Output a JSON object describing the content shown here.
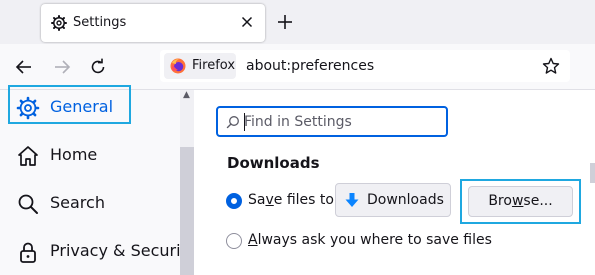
{
  "colors": {
    "accent": "#0061e0",
    "highlight_annotation": "#1fa8e0",
    "tab_background": "#ffffff",
    "chrome_background": "#f0f0f4"
  },
  "tab": {
    "title": "Settings",
    "icon": "gear-icon",
    "close_icon": "close-icon"
  },
  "toolbar": {
    "new_tab_icon": "plus-icon",
    "back_icon": "arrow-left-icon",
    "forward_icon": "arrow-right-icon",
    "reload_icon": "reload-icon"
  },
  "urlbar": {
    "identity_label": "Firefox",
    "url": "about:preferences",
    "bookmark_icon": "star-icon"
  },
  "sidebar": {
    "items": [
      {
        "label": "General",
        "icon": "gear-icon",
        "selected": true
      },
      {
        "label": "Home",
        "icon": "home-icon",
        "selected": false
      },
      {
        "label": "Search",
        "icon": "search-icon",
        "selected": false
      },
      {
        "label": "Privacy & Security",
        "icon": "lock-icon",
        "selected": false
      }
    ]
  },
  "search": {
    "placeholder": "Find in Settings",
    "value": ""
  },
  "downloads": {
    "heading": "Downloads",
    "save_files_label_prefix": "Sa",
    "save_files_label_accel": "v",
    "save_files_label_suffix": "e files to",
    "folder_label": "Downloads",
    "browse_label_prefix": "Bro",
    "browse_label_accel": "w",
    "browse_label_suffix": "se...",
    "always_ask_accel": "A",
    "always_ask_suffix": "lways ask you where to save files",
    "save_files_selected": true
  }
}
